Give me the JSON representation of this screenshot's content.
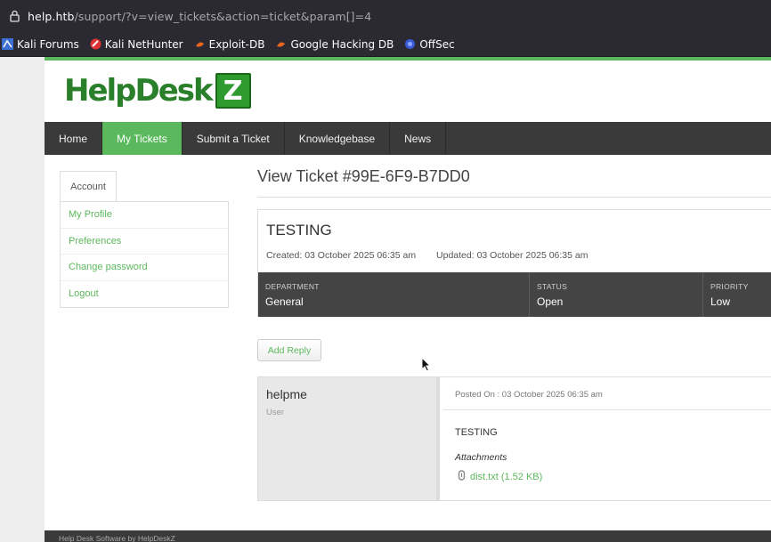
{
  "browser": {
    "url_host": "help.htb",
    "url_path": "/support/?v=view_tickets&action=ticket&param[]=4",
    "bookmarks": [
      {
        "label": "Kali Forums",
        "icon": "kali-forums-icon"
      },
      {
        "label": "Kali NetHunter",
        "icon": "kali-nethunter-icon"
      },
      {
        "label": "Exploit-DB",
        "icon": "exploit-db-icon"
      },
      {
        "label": "Google Hacking DB",
        "icon": "ghdb-icon"
      },
      {
        "label": "OffSec",
        "icon": "offsec-icon"
      }
    ]
  },
  "logo": {
    "word": "HelpDesk",
    "badge": "Z"
  },
  "nav": {
    "items": [
      {
        "label": "Home"
      },
      {
        "label": "My Tickets",
        "active": true
      },
      {
        "label": "Submit a Ticket"
      },
      {
        "label": "Knowledgebase"
      },
      {
        "label": "News"
      }
    ]
  },
  "sidebar": {
    "tab": "Account",
    "items": [
      {
        "label": "My Profile"
      },
      {
        "label": "Preferences"
      },
      {
        "label": "Change password"
      },
      {
        "label": "Logout"
      }
    ]
  },
  "ticket": {
    "view_title": "View Ticket #99E-6F9-B7DD0",
    "subject": "TESTING",
    "created": "Created: 03 October 2025 06:35 am",
    "updated": "Updated: 03 October 2025 06:35 am",
    "meta": [
      {
        "label": "DEPARTMENT",
        "value": "General"
      },
      {
        "label": "STATUS",
        "value": "Open"
      },
      {
        "label": "PRIORITY",
        "value": "Low"
      }
    ],
    "add_reply": "Add Reply"
  },
  "reply": {
    "user": "helpme",
    "role": "User",
    "posted": "Posted On : 03 October 2025 06:35 am",
    "message": "TESTING",
    "attachments_heading": "Attachments",
    "attachment": "dist.txt (1.52 KB)"
  },
  "footer": {
    "text": "Help Desk Software by HelpDeskZ"
  },
  "colors": {
    "accent": "#5cb85c",
    "nav": "#3a3a3a",
    "meta_bar": "#444444"
  }
}
